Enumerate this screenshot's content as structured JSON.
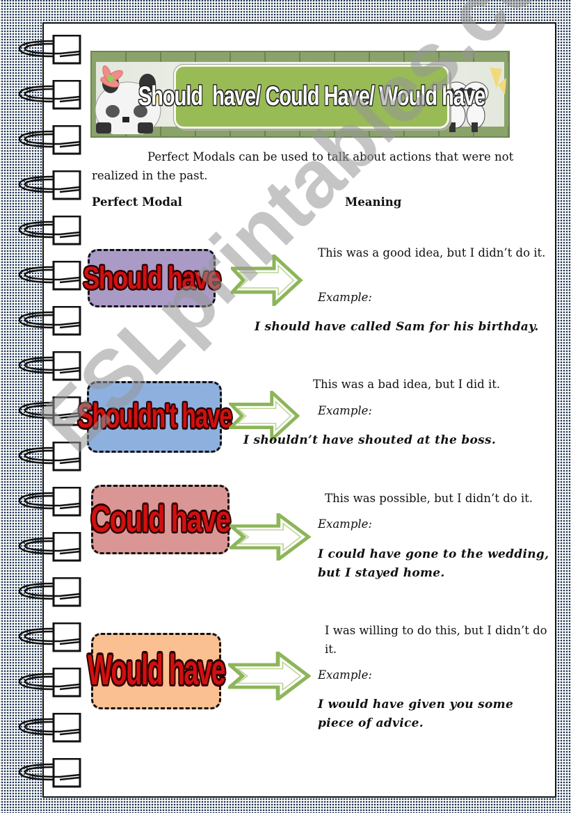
{
  "banner": {
    "title": "Should  have/ Could Have/ Would have"
  },
  "intro": {
    "text": "Perfect Modals can be used to talk about actions that were not realized in the past."
  },
  "headers": {
    "perfect_modal": "Perfect Modal",
    "meaning": "Meaning"
  },
  "example_label": "Example:",
  "modals": [
    {
      "label": "Should have",
      "color": "#a99bc6",
      "meaning": "This was a good idea, but I didn’t do it.",
      "example": "I should have called Sam for his birthday."
    },
    {
      "label": "Shouldn't have",
      "color": "#8db0df",
      "meaning": "This was a bad idea, but I did it.",
      "example": "I shouldn’t have shouted at the boss."
    },
    {
      "label": "Could have",
      "color": "#d99694",
      "meaning": "This was possible, but I didn’t do it.",
      "example": "I could have gone to the wedding, but I stayed home."
    },
    {
      "label": "Would have",
      "color": "#fac091",
      "meaning": "I was willing to do this, but I didn’t do it.",
      "example": "I would have given you some piece of advice."
    }
  ],
  "colors": {
    "arrow_green": "#8db55a",
    "label_red": "#d11010",
    "banner_green": "#98bb55"
  },
  "watermark": "ESLprintables.com"
}
